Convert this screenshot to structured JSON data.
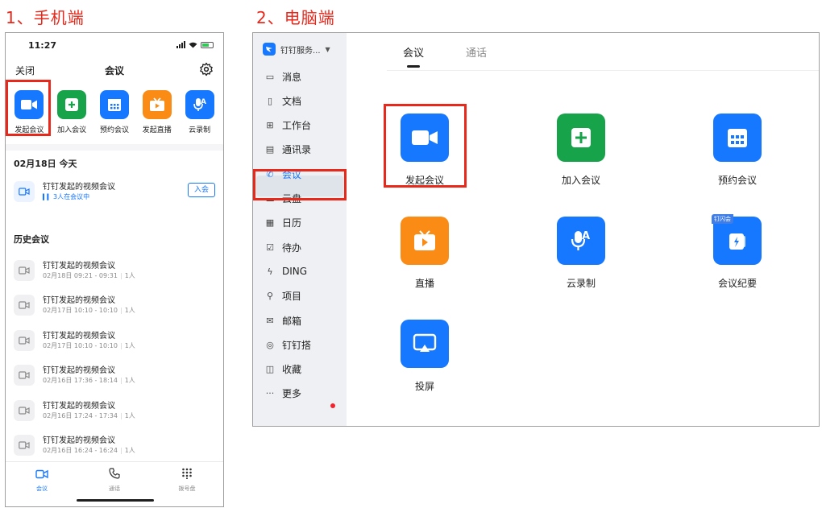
{
  "labels": {
    "phone": "1、手机端",
    "desktop": "2、电脑端"
  },
  "phone": {
    "time": "11:27",
    "nav": {
      "close": "关闭",
      "title": "会议"
    },
    "actions": [
      {
        "label": "发起会议",
        "icon": "video-camera-icon",
        "color": "#1677ff"
      },
      {
        "label": "加入会议",
        "icon": "plus-icon",
        "color": "#17a34a"
      },
      {
        "label": "预约会议",
        "icon": "calendar-icon",
        "color": "#1677ff"
      },
      {
        "label": "发起直播",
        "icon": "tv-play-icon",
        "color": "#fa8c16"
      },
      {
        "label": "云录制",
        "icon": "mic-a-icon",
        "color": "#1677ff"
      }
    ],
    "today": {
      "date_head": "02月18日 今天",
      "meeting": {
        "title": "钉钉发起的视频会议",
        "sub": "3人在会议中",
        "join": "入会"
      }
    },
    "history": {
      "head": "历史会议",
      "items": [
        {
          "title": "钉钉发起的视频会议",
          "time": "02月18日 09:21 - 09:31",
          "people": "1人"
        },
        {
          "title": "钉钉发起的视频会议",
          "time": "02月17日 10:10 - 10:10",
          "people": "1人"
        },
        {
          "title": "钉钉发起的视频会议",
          "time": "02月17日 10:10 - 10:10",
          "people": "1人"
        },
        {
          "title": "钉钉发起的视频会议",
          "time": "02月16日 17:36 - 18:14",
          "people": "1人"
        },
        {
          "title": "钉钉发起的视频会议",
          "time": "02月16日 17:24 - 17:34",
          "people": "1人"
        },
        {
          "title": "钉钉发起的视频会议",
          "time": "02月16日 16:24 - 16:24",
          "people": "1人"
        }
      ]
    },
    "tabs": [
      {
        "label": "会议",
        "icon": "video-camera-icon",
        "active": true
      },
      {
        "label": "通话",
        "icon": "phone-icon",
        "active": false
      },
      {
        "label": "拨号盘",
        "icon": "dialpad-icon",
        "active": false
      }
    ]
  },
  "desktop": {
    "org": "钉钉服务...",
    "sidebar": [
      {
        "label": "消息",
        "icon": "message-icon"
      },
      {
        "label": "文档",
        "icon": "document-icon"
      },
      {
        "label": "工作台",
        "icon": "workbench-icon"
      },
      {
        "label": "通讯录",
        "icon": "contacts-icon"
      },
      {
        "label": "会议",
        "icon": "meeting-icon",
        "active": true
      },
      {
        "label": "云盘",
        "icon": "cloud-icon"
      },
      {
        "label": "日历",
        "icon": "calendar-icon"
      },
      {
        "label": "待办",
        "icon": "todo-icon"
      },
      {
        "label": "DING",
        "icon": "ding-icon"
      },
      {
        "label": "项目",
        "icon": "project-icon"
      },
      {
        "label": "邮箱",
        "icon": "mail-icon"
      },
      {
        "label": "钉钉搭",
        "icon": "dingda-icon"
      },
      {
        "label": "收藏",
        "icon": "favorite-icon"
      },
      {
        "label": "更多",
        "icon": "more-icon"
      }
    ],
    "tabs": [
      {
        "label": "会议",
        "active": true
      },
      {
        "label": "通话",
        "active": false
      }
    ],
    "grid": [
      {
        "label": "发起会议",
        "icon": "video-camera-icon",
        "color": "#1677ff"
      },
      {
        "label": "加入会议",
        "icon": "plus-icon",
        "color": "#17a34a"
      },
      {
        "label": "预约会议",
        "icon": "calendar-icon",
        "color": "#1677ff"
      },
      {
        "label": "直播",
        "icon": "tv-play-icon",
        "color": "#fa8c16"
      },
      {
        "label": "云录制",
        "icon": "mic-a-icon",
        "color": "#1677ff"
      },
      {
        "label": "会议纪要",
        "icon": "minutes-icon",
        "color": "#1677ff",
        "tag": "钉闪会"
      },
      {
        "label": "投屏",
        "icon": "screen-cast-icon",
        "color": "#1677ff"
      }
    ]
  }
}
